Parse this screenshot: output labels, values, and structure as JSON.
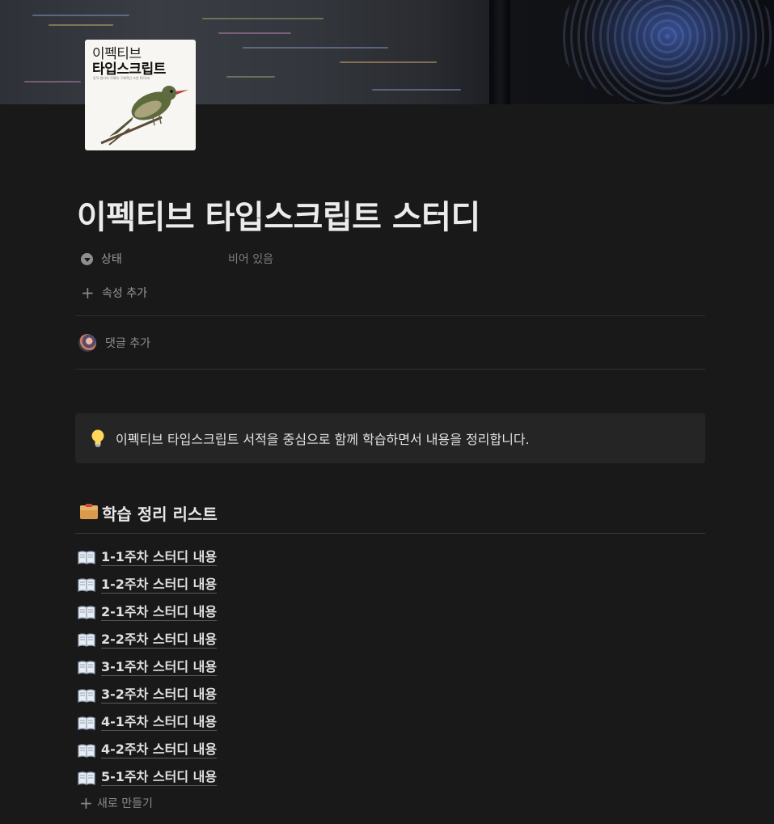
{
  "cover": {
    "alt": "cover image"
  },
  "page_icon": {
    "title_line1": "이펙티브",
    "title_line2": "타입스크립트",
    "subtitle": "동작 원리의 이해와 구체적인 조언 62가지"
  },
  "page": {
    "title": "이펙티브 타입스크립트 스터디"
  },
  "properties": [
    {
      "name": "상태",
      "icon": "status-icon",
      "value": "비어 있음"
    }
  ],
  "add_property_label": "속성 추가",
  "comment": {
    "label": "댓글 추가"
  },
  "callout": {
    "icon": "lightbulb-icon",
    "text": "이펙티브 타입스크립트 서적을 중심으로 함께 학습하면서 내용을 정리합니다."
  },
  "section": {
    "icon": "card-box-icon",
    "heading": "학습 정리 리스트"
  },
  "list": {
    "icon": "open-book-icon",
    "items": [
      "1-1주차 스터디 내용",
      "1-2주차 스터디 내용",
      "2-1주차 스터디 내용",
      "2-2주차 스터디 내용",
      "3-1주차 스터디 내용",
      "3-2주차 스터디 내용",
      "4-1주차 스터디 내용",
      "4-2주차 스터디 내용",
      "5-1주차 스터디 내용"
    ]
  },
  "new_item_label": "새로 만들기",
  "colors": {
    "background": "#191919",
    "callout_bg": "#252525",
    "text_primary": "#ebebeb",
    "text_muted": "#9b9b9b"
  }
}
